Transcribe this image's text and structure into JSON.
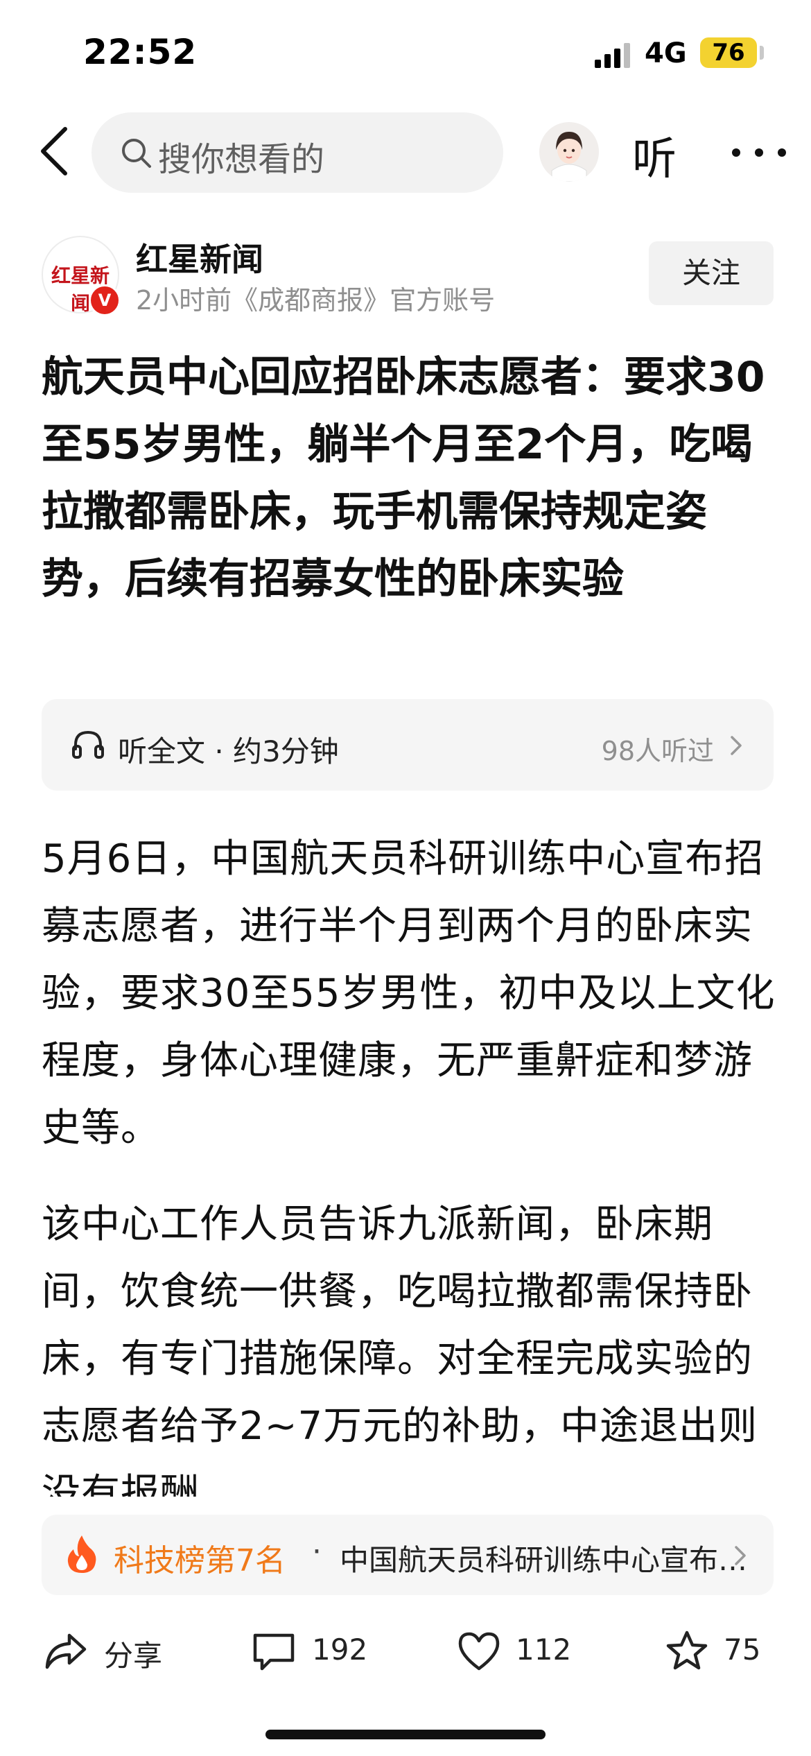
{
  "status_bar": {
    "time": "22:52",
    "network": "4G",
    "battery": "76",
    "battery_color": "#f3d230"
  },
  "nav": {
    "search_placeholder": "搜你想看的",
    "listen_label": "听"
  },
  "author": {
    "logo_text": "红星新闻",
    "verified": "V",
    "name": "红星新闻",
    "meta": "2小时前《成都商报》官方账号",
    "follow_label": "关注"
  },
  "article": {
    "title": "航天员中心回应招卧床志愿者：要求30至55岁男性，躺半个月至2个月，吃喝拉撒都需卧床，玩手机需保持规定姿势，后续有招募女性的卧床实验",
    "listen_bar": {
      "label": "听全文 · 约3分钟",
      "count": "98人听过"
    },
    "paragraphs": [
      "5月6日，中国航天员科研训练中心宣布招募志愿者，进行半个月到两个月的卧床实验，要求30至55岁男性，初中及以上文化程度，身体心理健康，无严重鼾症和梦游史等。",
      "该中心工作人员告诉九派新闻，卧床期间，饮食统一供餐，吃喝拉撒都需保持卧床，有专门措施保障。对全程完成实验的志愿者给予2~7万元的补助，中途退出则没有报酬。"
    ]
  },
  "rank": {
    "label": "科技榜第7名",
    "separator": "·",
    "topic": "中国航天员科研训练中心宣布招募卧床实验志愿者",
    "accent_color": "#f07a1a"
  },
  "actions": {
    "share": "分享",
    "comments": "192",
    "likes": "112",
    "favorites": "75"
  }
}
